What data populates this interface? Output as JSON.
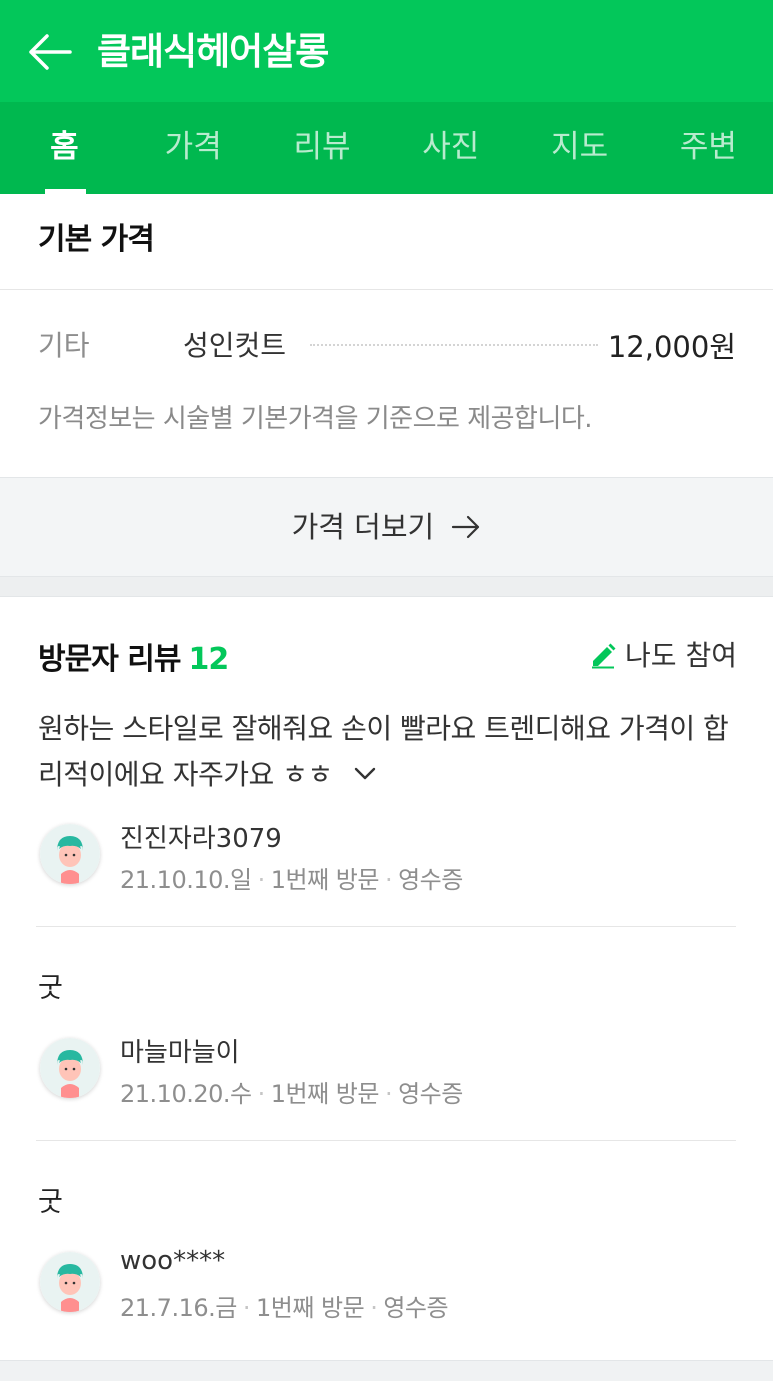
{
  "header": {
    "title": "클래식헤어살롱",
    "back_icon": "arrow-left-icon"
  },
  "tabs": [
    {
      "label": "홈",
      "active": true
    },
    {
      "label": "가격",
      "active": false
    },
    {
      "label": "리뷰",
      "active": false
    },
    {
      "label": "사진",
      "active": false
    },
    {
      "label": "지도",
      "active": false
    },
    {
      "label": "주변",
      "active": false
    }
  ],
  "price": {
    "section_title": "기본 가격",
    "items": [
      {
        "category": "기타",
        "name": "성인컷트",
        "price": "12,000원"
      }
    ],
    "note": "가격정보는 시술별 기본가격을 기준으로 제공합니다.",
    "more_label": "가격 더보기"
  },
  "reviews": {
    "section_title": "방문자 리뷰",
    "count": "12",
    "join_label": "나도 참여",
    "keywords": "원하는 스타일로 잘해줘요 손이 빨라요 트렌디해요 가격이 합리적이에요 자주가요 ㅎㅎ",
    "items": [
      {
        "text": "",
        "name": "진진자라3079",
        "date": "21.10.10.일",
        "visit": "1번째 방문",
        "receipt": "영수증"
      },
      {
        "text": "굿",
        "name": "마늘마늘이",
        "date": "21.10.20.수",
        "visit": "1번째 방문",
        "receipt": "영수증"
      },
      {
        "text": "굿",
        "name": "woo****",
        "date": "21.7.16.금",
        "visit": "1번째 방문",
        "receipt": "영수증"
      }
    ]
  },
  "colors": {
    "brand_green": "#03c75a",
    "tab_bar": "#00b84f"
  }
}
